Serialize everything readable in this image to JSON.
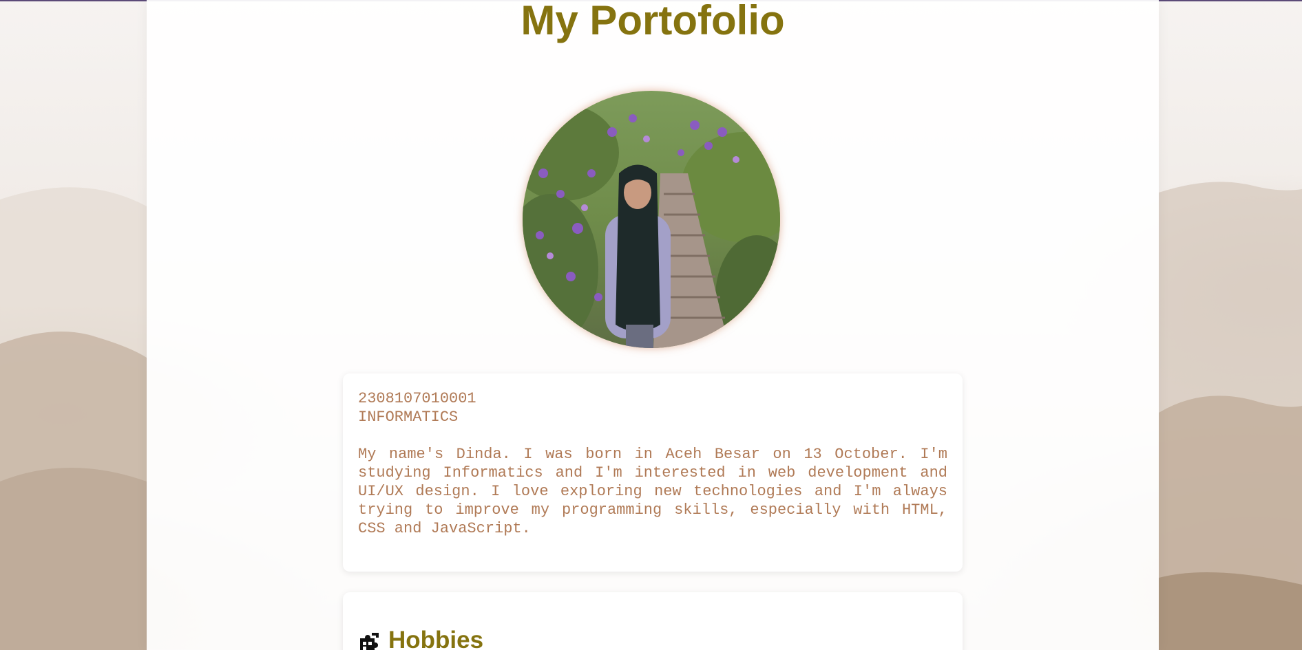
{
  "page": {
    "title": "My Portofolio"
  },
  "profile": {
    "photo_alt": "Profile photo",
    "student_id": "2308107010001",
    "major": "INFORMATICS",
    "bio": "My name's Dinda. I was born in Aceh Besar on 13 October. I'm studying Informatics and I'm interested in web development and UI/UX design. I love exploring new technologies and I'm always trying to improve my programming skills, especially with HTML, CSS and JavaScript."
  },
  "hobbies": {
    "heading": "Hobbies",
    "icon": "puzzle-icon"
  },
  "colors": {
    "title": "#85730f",
    "body_text": "#b07a56",
    "top_border": "#5b4a78",
    "card": "#ffffff"
  }
}
